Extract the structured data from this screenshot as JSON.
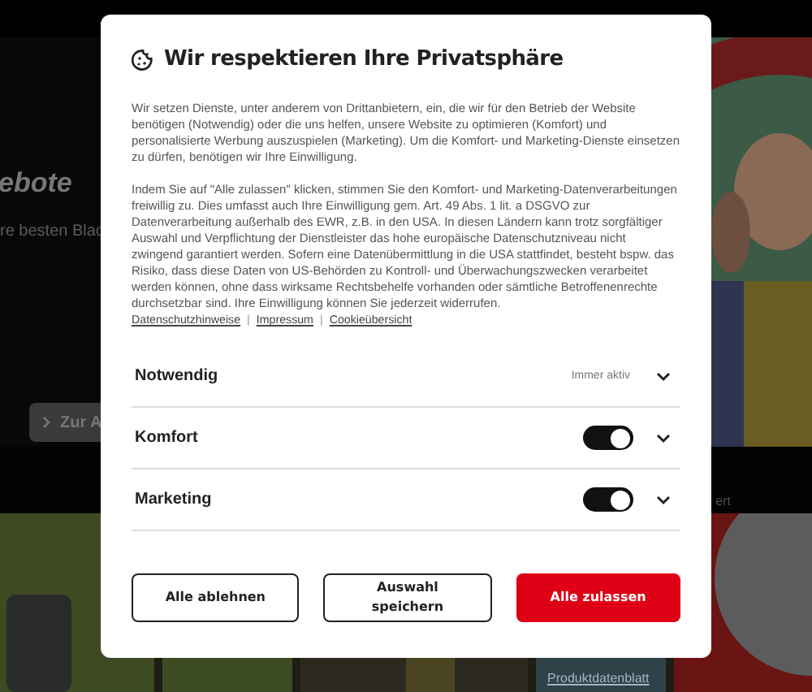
{
  "background": {
    "hero_heading": "ebote",
    "hero_subtitle": "re besten Blac",
    "hero_button": "Zur A",
    "caption": "ert",
    "product_link": "Produktdatenblatt"
  },
  "dialog": {
    "title": "Wir respektieren Ihre Privatsphäre",
    "paragraphs": [
      "Wir setzen Dienste, unter anderem von Drittanbietern, ein, die wir für den Betrieb der Website benötigen (Notwendig) oder die uns helfen, unsere Website zu optimieren (Komfort) und personalisierte Werbung auszuspielen (Marketing). Um die Komfort- und Marketing-Dienste einsetzen zu dürfen, benötigen wir Ihre Einwilligung.",
      "Indem Sie auf \"Alle zulassen\" klicken, stimmen Sie den Komfort- und Marketing-Datenverarbeitungen freiwillig zu. Dies umfasst auch Ihre Einwilligung gem. Art. 49 Abs. 1 lit. a DSGVO zur Datenverarbeitung außerhalb des EWR, z.B. in den USA. In diesen Ländern kann trotz sorgfältiger Auswahl und Verpflichtung der Dienstleister das hohe europäische Datenschutzniveau nicht zwingend garantiert werden. Sofern eine Datenübermittlung in die USA stattfindet, besteht bspw. das Risiko, dass diese Daten von US-Behörden zu Kontroll- und Überwachungszwecken verarbeitet werden können, ohne dass wirksame Rechtsbehelfe vorhanden oder sämtliche Betroffenenrechte durchsetzbar sind. Ihre Einwilligung können Sie jederzeit widerrufen."
    ],
    "links": [
      "Datenschutzhinweise",
      "Impressum",
      "Cookieübersicht"
    ],
    "link_separator": "|",
    "categories": [
      {
        "name": "Notwendig",
        "kind": "fixed",
        "status": "Immer aktiv",
        "expanded": false
      },
      {
        "name": "Komfort",
        "kind": "toggle",
        "on": true,
        "expanded": false
      },
      {
        "name": "Marketing",
        "kind": "toggle",
        "on": true,
        "expanded": false
      }
    ],
    "buttons": [
      {
        "label": "Alle ablehnen",
        "kind": "outline"
      },
      {
        "label": "Auswahl speichern",
        "kind": "outline"
      },
      {
        "label": "Alle zulassen",
        "kind": "primary"
      }
    ]
  }
}
